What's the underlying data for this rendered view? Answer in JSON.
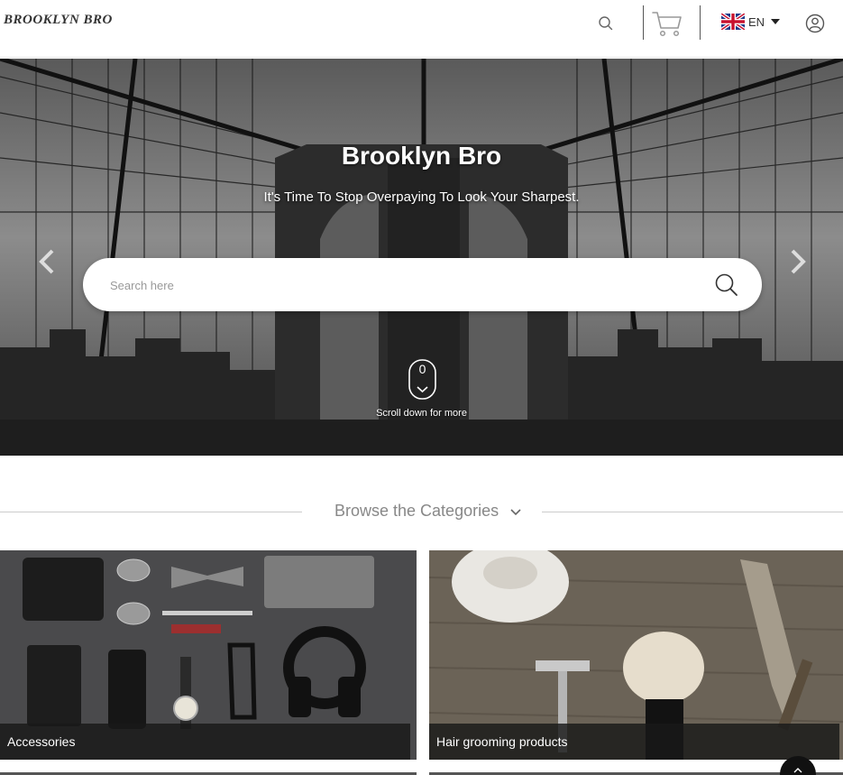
{
  "header": {
    "logo": "BROOKLYN BRO",
    "language": "EN",
    "icons": [
      "search-icon",
      "cart-icon",
      "uk-flag-icon",
      "user-icon"
    ]
  },
  "hero": {
    "title": "Brooklyn Bro",
    "subtitle": "It's Time To Stop Overpaying To Look Your Sharpest.",
    "search_placeholder": "Search here",
    "scroll_digit": "0",
    "scroll_text": "Scroll down for more"
  },
  "categories": {
    "heading": "Browse the Categories",
    "items": [
      {
        "label": "Accessories"
      },
      {
        "label": "Hair grooming products"
      }
    ]
  },
  "colors": {
    "header_bg": "#ffffff",
    "card_label_bg": "#191919",
    "accent_text": "#888888"
  }
}
